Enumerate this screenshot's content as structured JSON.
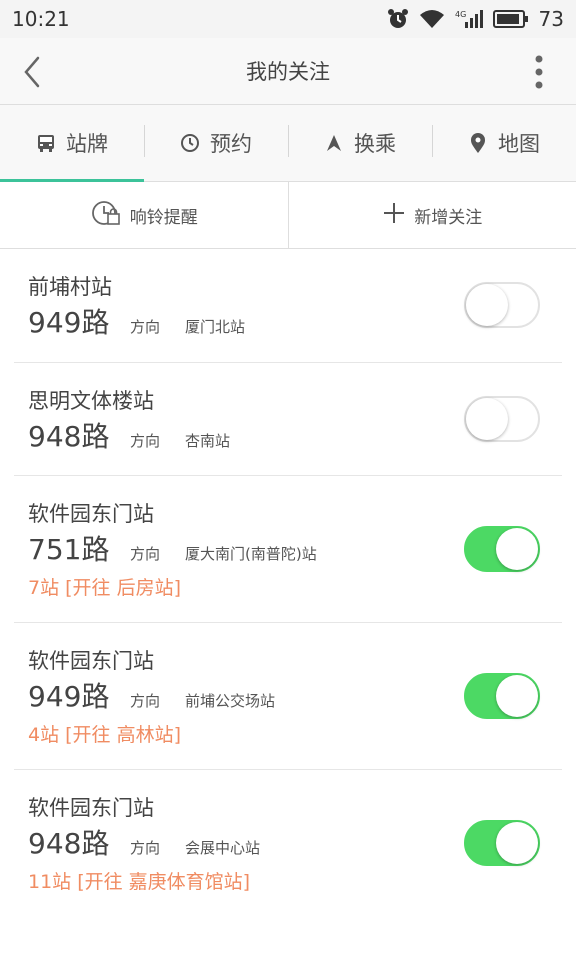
{
  "status_bar": {
    "time": "10:21",
    "signal": "4G",
    "battery": "73"
  },
  "header": {
    "title": "我的关注"
  },
  "tabs": [
    {
      "label": "站牌",
      "icon": "bus-icon",
      "active": true
    },
    {
      "label": "预约",
      "icon": "clock-icon",
      "active": false
    },
    {
      "label": "换乘",
      "icon": "navigation-arrow-icon",
      "active": false
    },
    {
      "label": "地图",
      "icon": "map-pin-icon",
      "active": false
    }
  ],
  "actions": {
    "alarm_label": "响铃提醒",
    "add_label": "新增关注"
  },
  "colors": {
    "accent": "#3cc39a",
    "toggle_on": "#4cd964",
    "eta": "#f08c62"
  },
  "favorites": [
    {
      "stop": "前埔村站",
      "route": "949路",
      "direction_label": "方向",
      "destination": "厦门北站",
      "eta": "",
      "enabled": false
    },
    {
      "stop": "思明文体楼站",
      "route": "948路",
      "direction_label": "方向",
      "destination": "杏南站",
      "eta": "",
      "enabled": false
    },
    {
      "stop": "软件园东门站",
      "route": "751路",
      "direction_label": "方向",
      "destination": "厦大南门(南普陀)站",
      "eta": "7站 [开往 后房站]",
      "enabled": true
    },
    {
      "stop": "软件园东门站",
      "route": "949路",
      "direction_label": "方向",
      "destination": "前埔公交场站",
      "eta": "4站 [开往 高林站]",
      "enabled": true
    },
    {
      "stop": "软件园东门站",
      "route": "948路",
      "direction_label": "方向",
      "destination": "会展中心站",
      "eta": "11站 [开往 嘉庚体育馆站]",
      "enabled": true
    }
  ]
}
